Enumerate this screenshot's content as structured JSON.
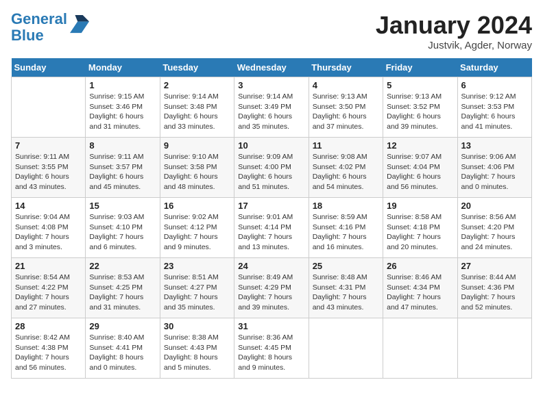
{
  "header": {
    "logo_line1": "General",
    "logo_line2": "Blue",
    "month": "January 2024",
    "location": "Justvik, Agder, Norway"
  },
  "days_of_week": [
    "Sunday",
    "Monday",
    "Tuesday",
    "Wednesday",
    "Thursday",
    "Friday",
    "Saturday"
  ],
  "weeks": [
    [
      {
        "day": "",
        "info": ""
      },
      {
        "day": "1",
        "info": "Sunrise: 9:15 AM\nSunset: 3:46 PM\nDaylight: 6 hours\nand 31 minutes."
      },
      {
        "day": "2",
        "info": "Sunrise: 9:14 AM\nSunset: 3:48 PM\nDaylight: 6 hours\nand 33 minutes."
      },
      {
        "day": "3",
        "info": "Sunrise: 9:14 AM\nSunset: 3:49 PM\nDaylight: 6 hours\nand 35 minutes."
      },
      {
        "day": "4",
        "info": "Sunrise: 9:13 AM\nSunset: 3:50 PM\nDaylight: 6 hours\nand 37 minutes."
      },
      {
        "day": "5",
        "info": "Sunrise: 9:13 AM\nSunset: 3:52 PM\nDaylight: 6 hours\nand 39 minutes."
      },
      {
        "day": "6",
        "info": "Sunrise: 9:12 AM\nSunset: 3:53 PM\nDaylight: 6 hours\nand 41 minutes."
      }
    ],
    [
      {
        "day": "7",
        "info": "Sunrise: 9:11 AM\nSunset: 3:55 PM\nDaylight: 6 hours\nand 43 minutes."
      },
      {
        "day": "8",
        "info": "Sunrise: 9:11 AM\nSunset: 3:57 PM\nDaylight: 6 hours\nand 45 minutes."
      },
      {
        "day": "9",
        "info": "Sunrise: 9:10 AM\nSunset: 3:58 PM\nDaylight: 6 hours\nand 48 minutes."
      },
      {
        "day": "10",
        "info": "Sunrise: 9:09 AM\nSunset: 4:00 PM\nDaylight: 6 hours\nand 51 minutes."
      },
      {
        "day": "11",
        "info": "Sunrise: 9:08 AM\nSunset: 4:02 PM\nDaylight: 6 hours\nand 54 minutes."
      },
      {
        "day": "12",
        "info": "Sunrise: 9:07 AM\nSunset: 4:04 PM\nDaylight: 6 hours\nand 56 minutes."
      },
      {
        "day": "13",
        "info": "Sunrise: 9:06 AM\nSunset: 4:06 PM\nDaylight: 7 hours\nand 0 minutes."
      }
    ],
    [
      {
        "day": "14",
        "info": "Sunrise: 9:04 AM\nSunset: 4:08 PM\nDaylight: 7 hours\nand 3 minutes."
      },
      {
        "day": "15",
        "info": "Sunrise: 9:03 AM\nSunset: 4:10 PM\nDaylight: 7 hours\nand 6 minutes."
      },
      {
        "day": "16",
        "info": "Sunrise: 9:02 AM\nSunset: 4:12 PM\nDaylight: 7 hours\nand 9 minutes."
      },
      {
        "day": "17",
        "info": "Sunrise: 9:01 AM\nSunset: 4:14 PM\nDaylight: 7 hours\nand 13 minutes."
      },
      {
        "day": "18",
        "info": "Sunrise: 8:59 AM\nSunset: 4:16 PM\nDaylight: 7 hours\nand 16 minutes."
      },
      {
        "day": "19",
        "info": "Sunrise: 8:58 AM\nSunset: 4:18 PM\nDaylight: 7 hours\nand 20 minutes."
      },
      {
        "day": "20",
        "info": "Sunrise: 8:56 AM\nSunset: 4:20 PM\nDaylight: 7 hours\nand 24 minutes."
      }
    ],
    [
      {
        "day": "21",
        "info": "Sunrise: 8:54 AM\nSunset: 4:22 PM\nDaylight: 7 hours\nand 27 minutes."
      },
      {
        "day": "22",
        "info": "Sunrise: 8:53 AM\nSunset: 4:25 PM\nDaylight: 7 hours\nand 31 minutes."
      },
      {
        "day": "23",
        "info": "Sunrise: 8:51 AM\nSunset: 4:27 PM\nDaylight: 7 hours\nand 35 minutes."
      },
      {
        "day": "24",
        "info": "Sunrise: 8:49 AM\nSunset: 4:29 PM\nDaylight: 7 hours\nand 39 minutes."
      },
      {
        "day": "25",
        "info": "Sunrise: 8:48 AM\nSunset: 4:31 PM\nDaylight: 7 hours\nand 43 minutes."
      },
      {
        "day": "26",
        "info": "Sunrise: 8:46 AM\nSunset: 4:34 PM\nDaylight: 7 hours\nand 47 minutes."
      },
      {
        "day": "27",
        "info": "Sunrise: 8:44 AM\nSunset: 4:36 PM\nDaylight: 7 hours\nand 52 minutes."
      }
    ],
    [
      {
        "day": "28",
        "info": "Sunrise: 8:42 AM\nSunset: 4:38 PM\nDaylight: 7 hours\nand 56 minutes."
      },
      {
        "day": "29",
        "info": "Sunrise: 8:40 AM\nSunset: 4:41 PM\nDaylight: 8 hours\nand 0 minutes."
      },
      {
        "day": "30",
        "info": "Sunrise: 8:38 AM\nSunset: 4:43 PM\nDaylight: 8 hours\nand 5 minutes."
      },
      {
        "day": "31",
        "info": "Sunrise: 8:36 AM\nSunset: 4:45 PM\nDaylight: 8 hours\nand 9 minutes."
      },
      {
        "day": "",
        "info": ""
      },
      {
        "day": "",
        "info": ""
      },
      {
        "day": "",
        "info": ""
      }
    ]
  ]
}
